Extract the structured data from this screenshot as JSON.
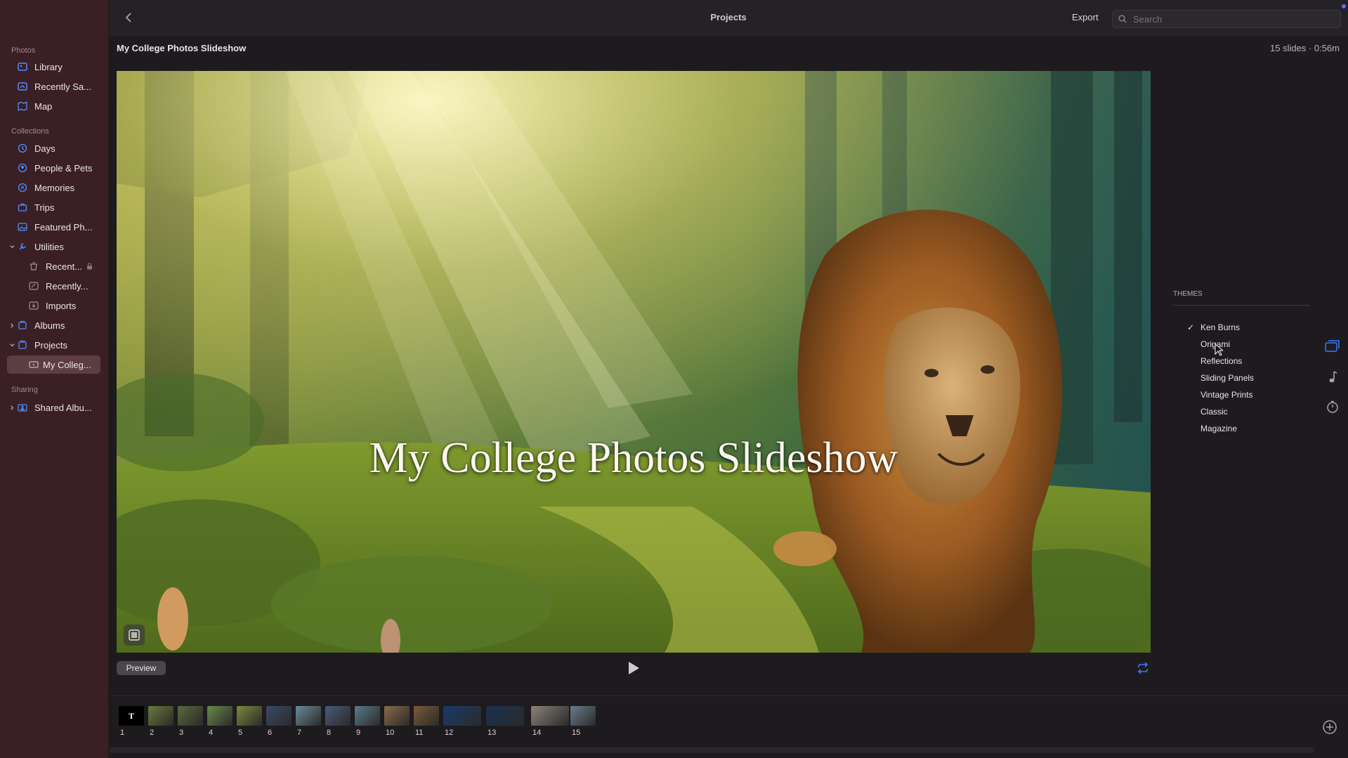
{
  "sidebar": {
    "sections": {
      "photos": "Photos",
      "collections": "Collections",
      "sharing": "Sharing"
    },
    "items": {
      "library": "Library",
      "recently_saved": "Recently Sa...",
      "map": "Map",
      "days": "Days",
      "people_pets": "People & Pets",
      "memories": "Memories",
      "trips": "Trips",
      "featured": "Featured Ph...",
      "utilities": "Utilities",
      "recently_deleted": "Recent...",
      "recently_edited": "Recently...",
      "imports": "Imports",
      "albums": "Albums",
      "projects": "Projects",
      "my_college": "My Colleg...",
      "shared_albums": "Shared Albu..."
    }
  },
  "topbar": {
    "title": "Projects",
    "export_label": "Export",
    "search_placeholder": "Search"
  },
  "header": {
    "slideshow_title": "My College Photos Slideshow",
    "slide_info": "15 slides · 0:56m"
  },
  "preview": {
    "overlay_title": "My College Photos Slideshow"
  },
  "controls": {
    "preview_label": "Preview"
  },
  "themes": {
    "heading": "THEMES",
    "selected": "Ken Burns",
    "check_mark": "✓",
    "items": [
      "Ken Burns",
      "Origami",
      "Reflections",
      "Sliding Panels",
      "Vintage Prints",
      "Classic",
      "Magazine"
    ]
  },
  "filmstrip": {
    "slides": [
      "1",
      "2",
      "3",
      "4",
      "5",
      "6",
      "7",
      "8",
      "9",
      "10",
      "11",
      "12",
      "13",
      "14",
      "15"
    ],
    "first_slide_glyph": "T"
  },
  "colors": {
    "sidebar_bg": "#3a2025",
    "accent": "#3a7bff",
    "window_bg": "#1e1b1e"
  }
}
